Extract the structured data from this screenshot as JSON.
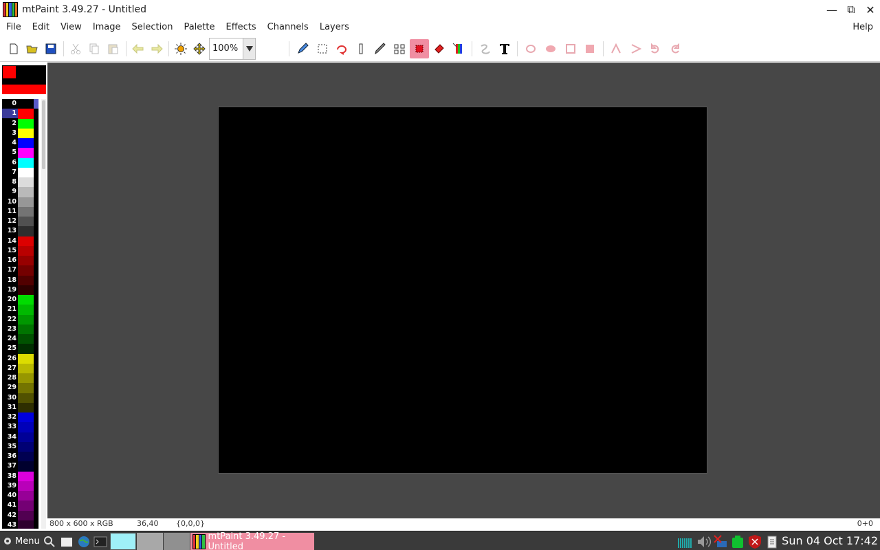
{
  "window": {
    "title": "mtPaint 3.49.27 - Untitled",
    "controls": {
      "minimize": "—",
      "maximize": "⧉",
      "close": "✕"
    }
  },
  "menu": {
    "items": [
      "File",
      "Edit",
      "View",
      "Image",
      "Selection",
      "Palette",
      "Effects",
      "Channels",
      "Layers"
    ],
    "help": "Help"
  },
  "toolbar": {
    "zoom_value": "100%",
    "icons": [
      "new-icon",
      "open-icon",
      "save-icon",
      "cut-icon",
      "copy-icon",
      "paste-icon",
      "undo-icon",
      "redo-icon",
      "brightness-icon",
      "move-icon",
      "paint-icon",
      "select-icon",
      "lasso-icon",
      "line-icon",
      "smudge-icon",
      "clone-icon",
      "fill-icon",
      "flood-icon",
      "pick-icon",
      "text-icon"
    ]
  },
  "colors": {
    "a": "#ff0000",
    "b": "#000000",
    "accent_selected": "#f08ea2",
    "canvas_bg": "#474747"
  },
  "palette": [
    {
      "index": "0",
      "color": "#000000"
    },
    {
      "index": "1",
      "color": "#ff0000"
    },
    {
      "index": "2",
      "color": "#00ff00"
    },
    {
      "index": "3",
      "color": "#ffff00"
    },
    {
      "index": "4",
      "color": "#0000ff"
    },
    {
      "index": "5",
      "color": "#ff00ff"
    },
    {
      "index": "6",
      "color": "#00ffff"
    },
    {
      "index": "7",
      "color": "#ffffff"
    },
    {
      "index": "8",
      "color": "#dcdcdc"
    },
    {
      "index": "9",
      "color": "#b9b9b9"
    },
    {
      "index": "10",
      "color": "#979797"
    },
    {
      "index": "11",
      "color": "#747474"
    },
    {
      "index": "12",
      "color": "#515151"
    },
    {
      "index": "13",
      "color": "#2e2e2e"
    },
    {
      "index": "14",
      "color": "#dc0000"
    },
    {
      "index": "15",
      "color": "#b90000"
    },
    {
      "index": "16",
      "color": "#970000"
    },
    {
      "index": "17",
      "color": "#740000"
    },
    {
      "index": "18",
      "color": "#510000"
    },
    {
      "index": "19",
      "color": "#2e0000"
    },
    {
      "index": "20",
      "color": "#00dc00"
    },
    {
      "index": "21",
      "color": "#00b900"
    },
    {
      "index": "22",
      "color": "#009700"
    },
    {
      "index": "23",
      "color": "#007400"
    },
    {
      "index": "24",
      "color": "#005100"
    },
    {
      "index": "25",
      "color": "#002e00"
    },
    {
      "index": "26",
      "color": "#dcdc00"
    },
    {
      "index": "27",
      "color": "#b9b900"
    },
    {
      "index": "28",
      "color": "#979700"
    },
    {
      "index": "29",
      "color": "#747400"
    },
    {
      "index": "30",
      "color": "#515100"
    },
    {
      "index": "31",
      "color": "#2e2e00"
    },
    {
      "index": "32",
      "color": "#0000dc"
    },
    {
      "index": "33",
      "color": "#0000b9"
    },
    {
      "index": "34",
      "color": "#000097"
    },
    {
      "index": "35",
      "color": "#000074"
    },
    {
      "index": "36",
      "color": "#000051"
    },
    {
      "index": "37",
      "color": "#00002e"
    },
    {
      "index": "38",
      "color": "#dc00dc"
    },
    {
      "index": "39",
      "color": "#b900b9"
    },
    {
      "index": "40",
      "color": "#970097"
    },
    {
      "index": "41",
      "color": "#740074"
    },
    {
      "index": "42",
      "color": "#510051"
    },
    {
      "index": "43",
      "color": "#2e002e"
    }
  ],
  "palette_selected": "1",
  "status": {
    "image_info": "800 x 600 x RGB",
    "cursor": "36,40",
    "pixel": "{0,0,0}",
    "layers": "0+0"
  },
  "taskbar": {
    "menu_label": "Menu",
    "task_title": "mtPaint 3.49.27 - Untitled",
    "clock": "Sun 04 Oct 17:42"
  }
}
